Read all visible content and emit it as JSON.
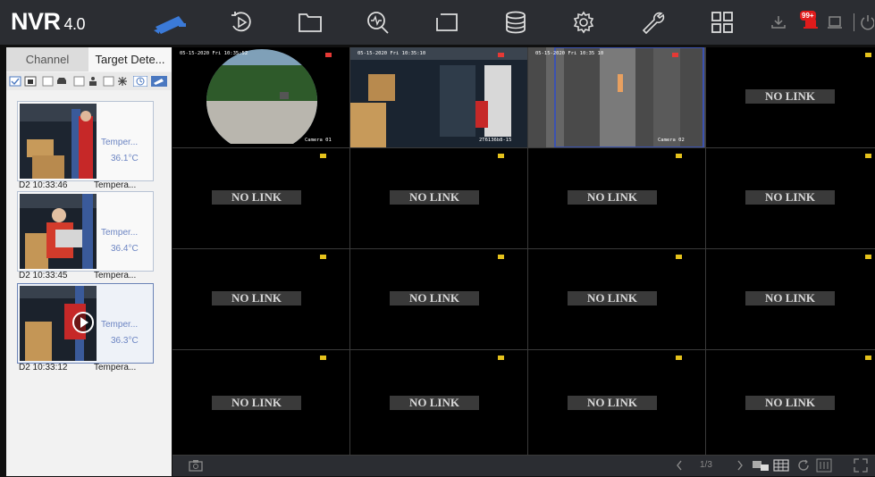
{
  "header": {
    "logo_main": "NVR",
    "logo_version": "4.0",
    "alarm_badge": "99+",
    "icons": [
      "camera-icon",
      "playback-icon",
      "folder-icon",
      "search-icon",
      "screen-icon",
      "storage-icon",
      "settings-icon",
      "maintenance-icon",
      "grid-view-icon",
      "download-icon",
      "alarm-icon",
      "screenshot-icon",
      "power-icon"
    ]
  },
  "sidebar": {
    "tabs": [
      "Channel",
      "Target Dete..."
    ],
    "events": [
      {
        "temp_label": "Temper...",
        "temp_value": "36.1°C",
        "time": "D2 10:33:46",
        "type": "Tempera..."
      },
      {
        "temp_label": "Temper...",
        "temp_value": "36.4°C",
        "time": "D2 10:33:45",
        "type": "Tempera..."
      },
      {
        "temp_label": "Temper...",
        "temp_value": "36.3°C",
        "time": "D2 10:33:12",
        "type": "Tempera..."
      }
    ]
  },
  "video": {
    "cam1": {
      "osd": "05-15-2020 Fri 10:35:52",
      "name": "Camera 01"
    },
    "cam2": {
      "osd": "05-15-2020 Fri 10:35:10",
      "name": "2T6136b8-15"
    },
    "cam3": {
      "osd": "05-15-2020 Fri 10:35 10",
      "name": "Camera 02"
    },
    "no_link_label": "NO LINK"
  },
  "bottom": {
    "page": "1/3"
  },
  "colors": {
    "topbar": "#2b2d32",
    "accent_blue": "#3b7ad8",
    "alarm_red": "#e01b1b",
    "flag_yellow": "#e5c21c"
  }
}
